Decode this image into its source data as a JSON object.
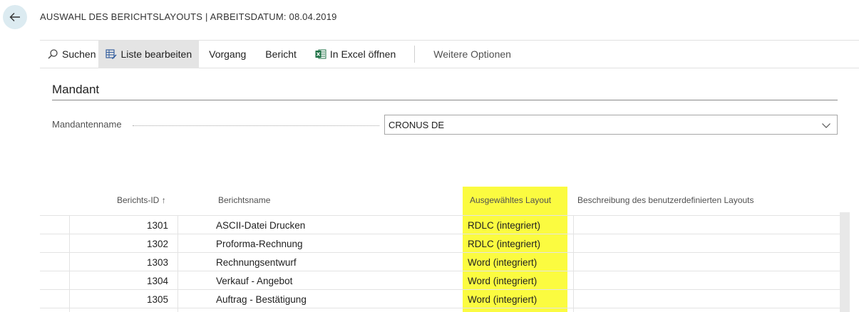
{
  "header": {
    "title": "AUSWAHL DES BERICHTSLAYOUTS | ARBEITSDATUM: 08.04.2019",
    "back_icon": "arrow-left-icon"
  },
  "actionbar": {
    "search": "Suchen",
    "edit_list": "Liste bearbeiten",
    "vorgang": "Vorgang",
    "bericht": "Bericht",
    "excel": "In Excel öffnen",
    "more": "Weitere Optionen"
  },
  "group": {
    "title": "Mandant",
    "field_label": "Mandantenname",
    "field_value": "CRONUS DE"
  },
  "table": {
    "columns": {
      "id": "Berichts-ID",
      "sort_arrow": "↑",
      "name": "Berichtsname",
      "layout": "Ausgewähltes Layout",
      "description": "Beschreibung des benutzerdefinierten Layouts"
    },
    "rows": [
      {
        "id": "1301",
        "name": "ASCII-Datei Drucken",
        "layout": "RDLC (integriert)",
        "description": ""
      },
      {
        "id": "1302",
        "name": "Proforma-Rechnung",
        "layout": "RDLC (integriert)",
        "description": ""
      },
      {
        "id": "1303",
        "name": "Rechnungsentwurf",
        "layout": "Word (integriert)",
        "description": ""
      },
      {
        "id": "1304",
        "name": "Verkauf - Angebot",
        "layout": "Word (integriert)",
        "description": ""
      },
      {
        "id": "1305",
        "name": "Auftrag - Bestätigung",
        "layout": "Word (integriert)",
        "description": ""
      }
    ]
  },
  "colors": {
    "highlight": "#fbfb40",
    "back_button_bg": "#dcebf1",
    "excel_green": "#1e7145"
  }
}
